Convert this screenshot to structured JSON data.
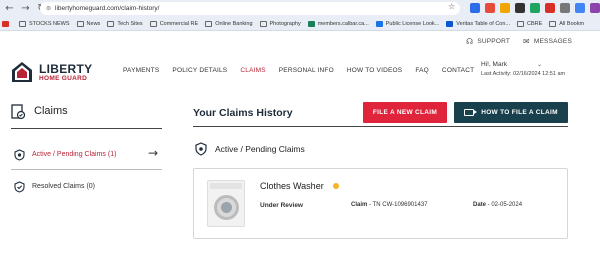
{
  "browser": {
    "url": "libertyhomeguard.com/claim-history/",
    "bookmarks": [
      {
        "label": "",
        "color": "#d93025",
        "folder": false
      },
      {
        "label": "STOCKS NEWS",
        "color": "#555",
        "folder": true
      },
      {
        "label": "News",
        "color": "#555",
        "folder": true
      },
      {
        "label": "Tech Sites",
        "color": "#555",
        "folder": true
      },
      {
        "label": "Commercial RE",
        "color": "#555",
        "folder": true
      },
      {
        "label": "Online Banking",
        "color": "#555",
        "folder": true
      },
      {
        "label": "Photography",
        "color": "#555",
        "folder": true
      },
      {
        "label": "members.calbar.ca...",
        "color": "#1a7f5a",
        "folder": false
      },
      {
        "label": "Public License Look...",
        "color": "#1a73e8",
        "folder": false
      },
      {
        "label": "Veritas Table of Con...",
        "color": "#0b57d0",
        "folder": false
      },
      {
        "label": "CBRE",
        "color": "#555",
        "folder": true
      },
      {
        "label": "All Bookm",
        "color": "#555",
        "folder": true
      }
    ]
  },
  "utility": {
    "support": "SUPPORT",
    "messages": "MESSAGES",
    "messages_count": "0"
  },
  "logo": {
    "line1": "LIBERTY",
    "line2": "HOME GUARD"
  },
  "nav": {
    "items": [
      "PAYMENTS",
      "POLICY DETAILS",
      "CLAIMS",
      "PERSONAL INFO",
      "HOW TO VIDEOS",
      "FAQ",
      "CONTACT"
    ],
    "active": "CLAIMS"
  },
  "user": {
    "greeting": "Hi!, Mark",
    "last_activity": "Last Activity: 02/16/2024 12:51 am"
  },
  "sidebar": {
    "title": "Claims",
    "items": [
      {
        "label": "Active / Pending Claims (1)"
      },
      {
        "label": "Resolved Claims (0)"
      }
    ]
  },
  "main": {
    "title": "Your Claims History",
    "file_button": "FILE A NEW CLAIM",
    "how_button": "HOW TO FILE A CLAIM",
    "section_title": "Active / Pending Claims",
    "claim": {
      "item": "Clothes Washer",
      "status": "Under Review",
      "claim_label": "Claim",
      "claim_number": " - TN CW-1096901437",
      "date_label": "Date",
      "date_value": " - 02-05-2024",
      "status_color": "#f3b324"
    }
  },
  "colors": {
    "brand_red": "#b72437",
    "button_red": "#e0243b",
    "button_teal": "#18404d",
    "navy": "#1e2c3a"
  }
}
